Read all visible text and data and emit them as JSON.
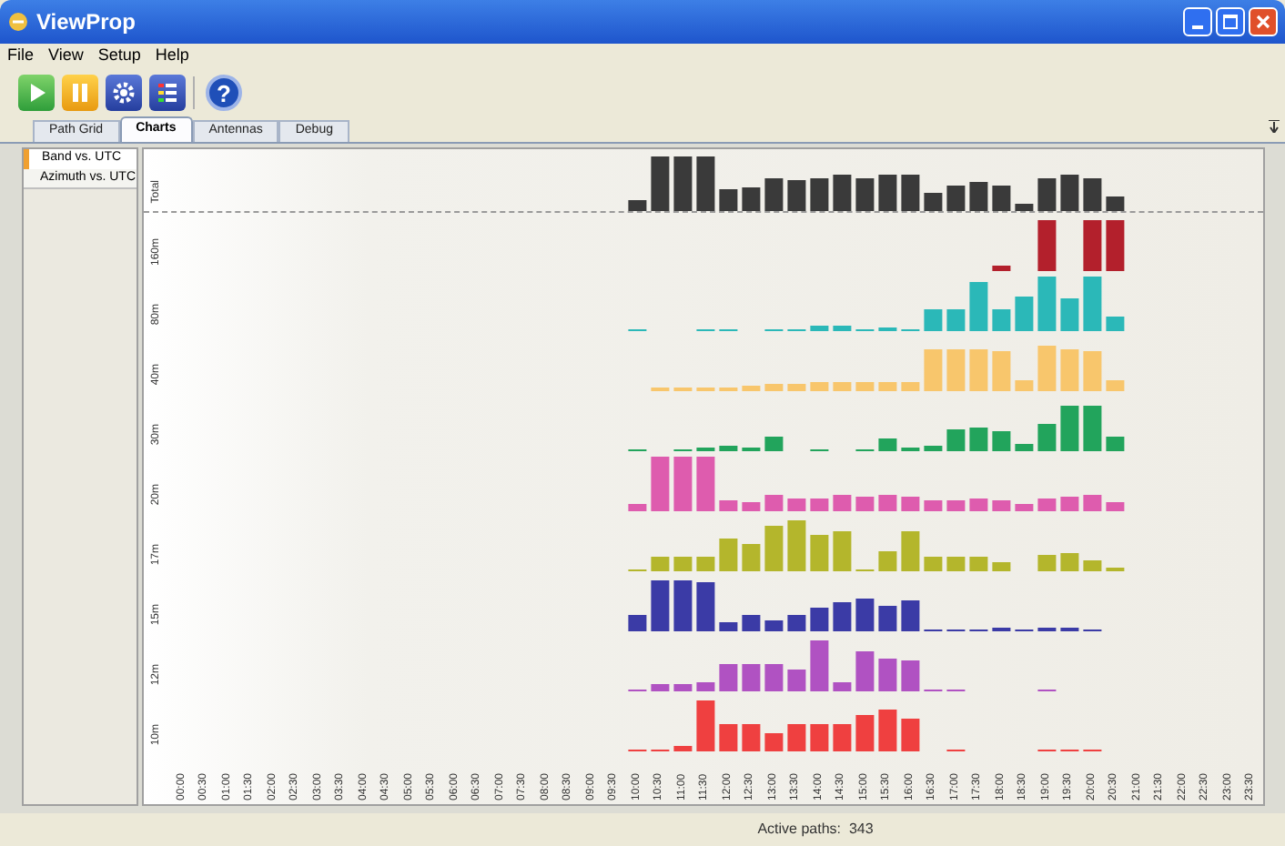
{
  "window": {
    "title": "ViewProp"
  },
  "menu": [
    "File",
    "View",
    "Setup",
    "Help"
  ],
  "toolbar": [
    {
      "kind": "play"
    },
    {
      "kind": "pause"
    },
    {
      "kind": "settings"
    },
    {
      "kind": "list"
    },
    {
      "kind": "help",
      "glyph": "?"
    }
  ],
  "tabs": [
    {
      "label": "Path Grid",
      "selected": false
    },
    {
      "label": "Charts",
      "selected": true
    },
    {
      "label": "Antennas",
      "selected": false
    },
    {
      "label": "Debug",
      "selected": false
    }
  ],
  "sidebar": {
    "items": [
      {
        "label": "Band vs. UTC",
        "selected": true
      },
      {
        "label": "Azimuth vs. UTC",
        "selected": false
      }
    ]
  },
  "chart": {
    "bands": [
      {
        "label": "Total",
        "color": "#3a3a3a"
      },
      {
        "label": "160m",
        "color": "#b3202c"
      },
      {
        "label": "80m",
        "color": "#2bb8b8"
      },
      {
        "label": "40m",
        "color": "#f8c66c"
      },
      {
        "label": "30m",
        "color": "#22a45c"
      },
      {
        "label": "20m",
        "color": "#de5cae"
      },
      {
        "label": "17m",
        "color": "#b4b62c"
      },
      {
        "label": "15m",
        "color": "#3b3ba6"
      },
      {
        "label": "12m",
        "color": "#b052c2"
      },
      {
        "label": "10m",
        "color": "#ef4040"
      }
    ],
    "time_labels": [
      "00:00",
      "00:30",
      "01:00",
      "01:30",
      "02:00",
      "02:30",
      "03:00",
      "03:30",
      "04:00",
      "04:30",
      "05:00",
      "05:30",
      "06:00",
      "06:30",
      "07:00",
      "07:30",
      "08:00",
      "08:30",
      "09:00",
      "09:30",
      "10:00",
      "10:30",
      "11:00",
      "11:30",
      "12:00",
      "12:30",
      "13:00",
      "13:30",
      "14:00",
      "14:30",
      "15:00",
      "15:30",
      "16:00",
      "16:30",
      "17:00",
      "17:30",
      "18:00",
      "18:30",
      "19:00",
      "19:30",
      "20:00",
      "20:30",
      "21:00",
      "21:30",
      "22:00",
      "22:30",
      "23:00",
      "23:30"
    ]
  },
  "status_bar": {
    "text": "Active paths:  343"
  }
}
